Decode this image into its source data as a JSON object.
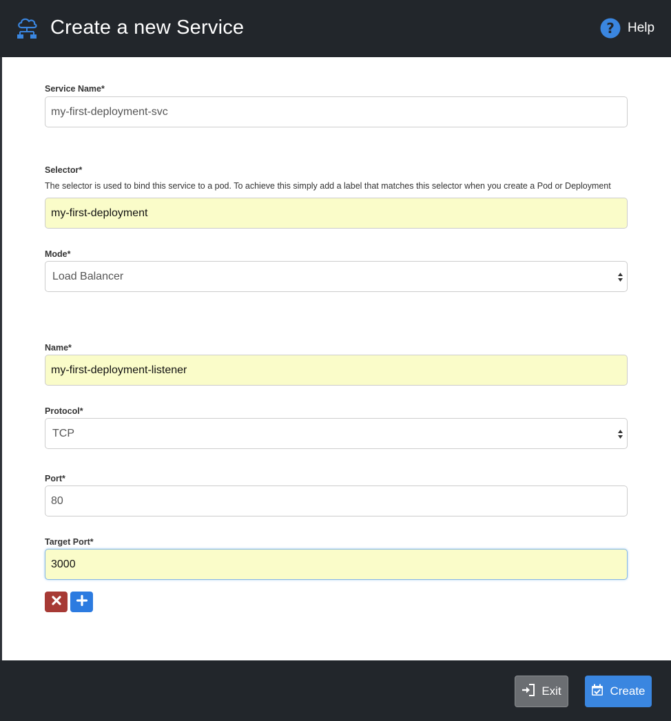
{
  "header": {
    "title": "Create a new Service",
    "help_label": "Help",
    "logo_icon": "cloud-network-icon",
    "help_icon": "question-circle-icon"
  },
  "form": {
    "service_name": {
      "label": "Service Name*",
      "value": "my-first-deployment-svc"
    },
    "selector": {
      "label": "Selector*",
      "help": "The selector is used to bind this service to a pod. To achieve this simply add a label that matches this selector when you create a Pod or Deployment",
      "value": "my-first-deployment"
    },
    "mode": {
      "label": "Mode*",
      "selected": "Load Balancer"
    },
    "listener": {
      "name": {
        "label": "Name*",
        "value": "my-first-deployment-listener"
      },
      "protocol": {
        "label": "Protocol*",
        "selected": "TCP"
      },
      "port": {
        "label": "Port*",
        "value": "80"
      },
      "target_port": {
        "label": "Target Port*",
        "value": "3000"
      }
    },
    "remove_icon": "times-icon",
    "add_icon": "plus-icon"
  },
  "footer": {
    "exit_label": "Exit",
    "create_label": "Create",
    "exit_icon": "sign-in-icon",
    "create_icon": "calendar-check-icon"
  },
  "colors": {
    "header_bg": "#22262b",
    "autofill_bg": "#fafcc9",
    "remove_button": "#a73a35",
    "add_button": "#2c7be0",
    "create_button": "#3a86e0",
    "exit_button": "#6b6e72"
  }
}
